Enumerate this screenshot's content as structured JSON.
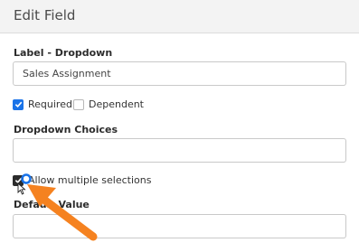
{
  "header": {
    "title": "Edit Field"
  },
  "form": {
    "label_field": {
      "label": "Label - Dropdown",
      "value": "Sales Assignment"
    },
    "required": {
      "label": "Required",
      "checked": true
    },
    "dependent": {
      "label": "Dependent",
      "checked": false
    },
    "choices": {
      "label": "Dropdown Choices",
      "value": ""
    },
    "allow_multiple": {
      "label": "Allow multiple selections",
      "checked": true
    },
    "default_value": {
      "label": "Default Value",
      "value": ""
    }
  },
  "colors": {
    "accent": "#1a73e8",
    "arrow": "#f58220"
  }
}
